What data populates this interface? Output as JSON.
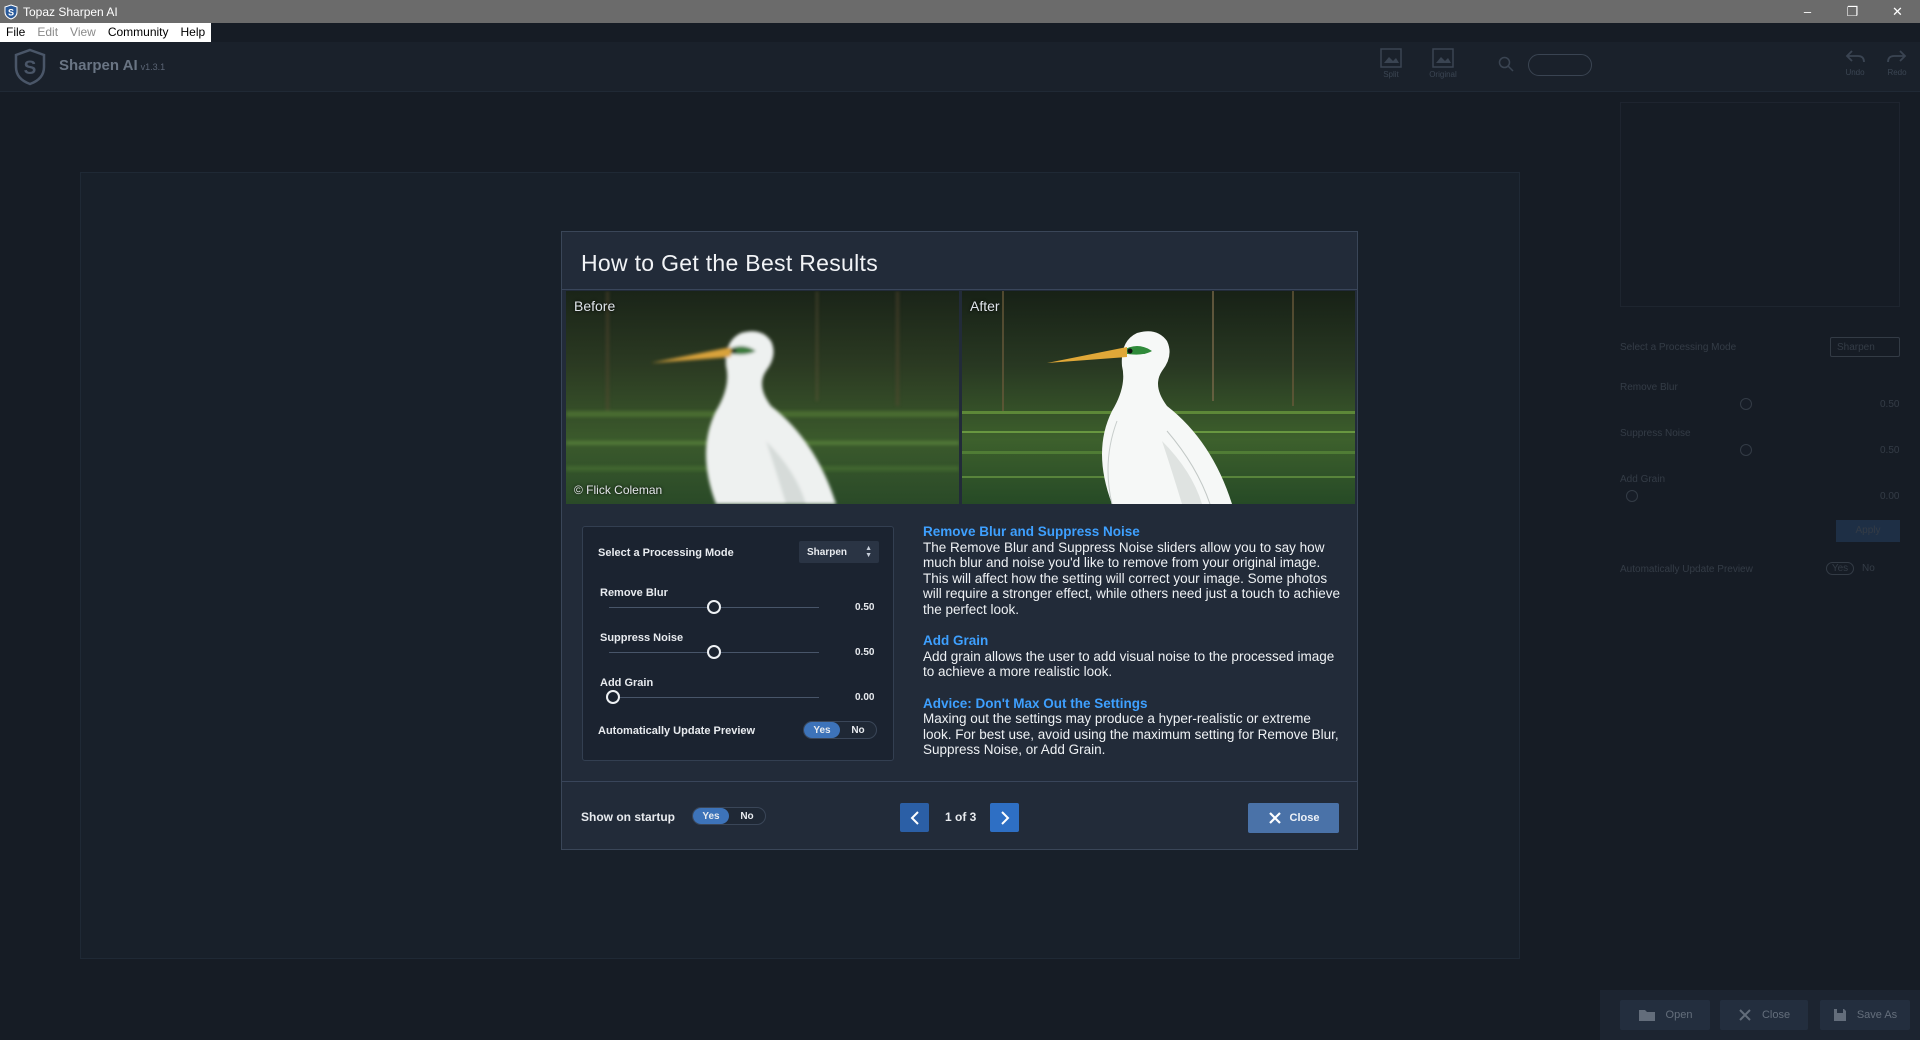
{
  "window": {
    "title": "Topaz Sharpen AI",
    "controls": [
      "–",
      "❐",
      "✕"
    ]
  },
  "menu": [
    {
      "label": "File",
      "disabled": false
    },
    {
      "label": "Edit",
      "disabled": true
    },
    {
      "label": "View",
      "disabled": true
    },
    {
      "label": "Community",
      "disabled": false
    },
    {
      "label": "Help",
      "disabled": false
    }
  ],
  "app": {
    "name": "Sharpen AI",
    "version": "v1.3.1",
    "header_tools": [
      {
        "icon": "grid-view-icon",
        "label": "Split"
      },
      {
        "icon": "image-view-icon",
        "label": "Original"
      },
      {
        "icon": "zoom-icon",
        "label": ""
      },
      {
        "icon": "undo-icon",
        "label": "Undo"
      },
      {
        "icon": "redo-icon",
        "label": "Redo"
      }
    ]
  },
  "side_panel": {
    "mode_label": "Select a Processing Mode",
    "mode_value": "Sharpen",
    "sliders": [
      {
        "label": "Remove Blur",
        "value": "0.50"
      },
      {
        "label": "Suppress Noise",
        "value": "0.50"
      },
      {
        "label": "Add Grain",
        "value": "0.00"
      }
    ],
    "apply_label": "Apply",
    "auto_update_label": "Automatically Update Preview",
    "yes": "Yes",
    "no": "No"
  },
  "bottom_bar": {
    "open": "Open",
    "close": "Close",
    "save_as": "Save As"
  },
  "dialog": {
    "title": "How to Get the Best Results",
    "before_label": "Before",
    "after_label": "After",
    "credit": "© Flick Coleman",
    "preview": {
      "mode_label": "Select a Processing Mode",
      "mode_value": "Sharpen",
      "sliders": [
        {
          "label": "Remove Blur",
          "value": "0.50",
          "level": 0.5
        },
        {
          "label": "Suppress Noise",
          "value": "0.50",
          "level": 0.5
        },
        {
          "label": "Add Grain",
          "value": "0.00",
          "level": 0.0
        }
      ],
      "auto_update_label": "Automatically Update Preview",
      "yes": "Yes",
      "no": "No"
    },
    "sections": [
      {
        "heading": "Remove Blur and Suppress Noise",
        "body": "The Remove Blur and Suppress Noise sliders allow you to say how much blur and noise you'd like to remove from your original image. This will affect how the setting will correct your image. Some photos will require a stronger effect, while others need just a touch to achieve the perfect look."
      },
      {
        "heading": "Add Grain",
        "body": "Add grain allows the user to add visual noise to the processed image to achieve a more realistic look."
      },
      {
        "heading": "Advice: Don't Max Out the Settings",
        "body": "Maxing out the settings may produce a hyper-realistic or extreme look. For best use, avoid using the maximum setting for Remove Blur, Suppress Noise, or Add Grain."
      }
    ],
    "startup_label": "Show on startup",
    "startup_yes": "Yes",
    "startup_no": "No",
    "pager": "1 of 3",
    "close_label": "Close"
  },
  "colors": {
    "accent": "#3d73b9",
    "link": "#3ea0ff",
    "modal_bg": "#222b39",
    "app_bg": "#161c25"
  }
}
